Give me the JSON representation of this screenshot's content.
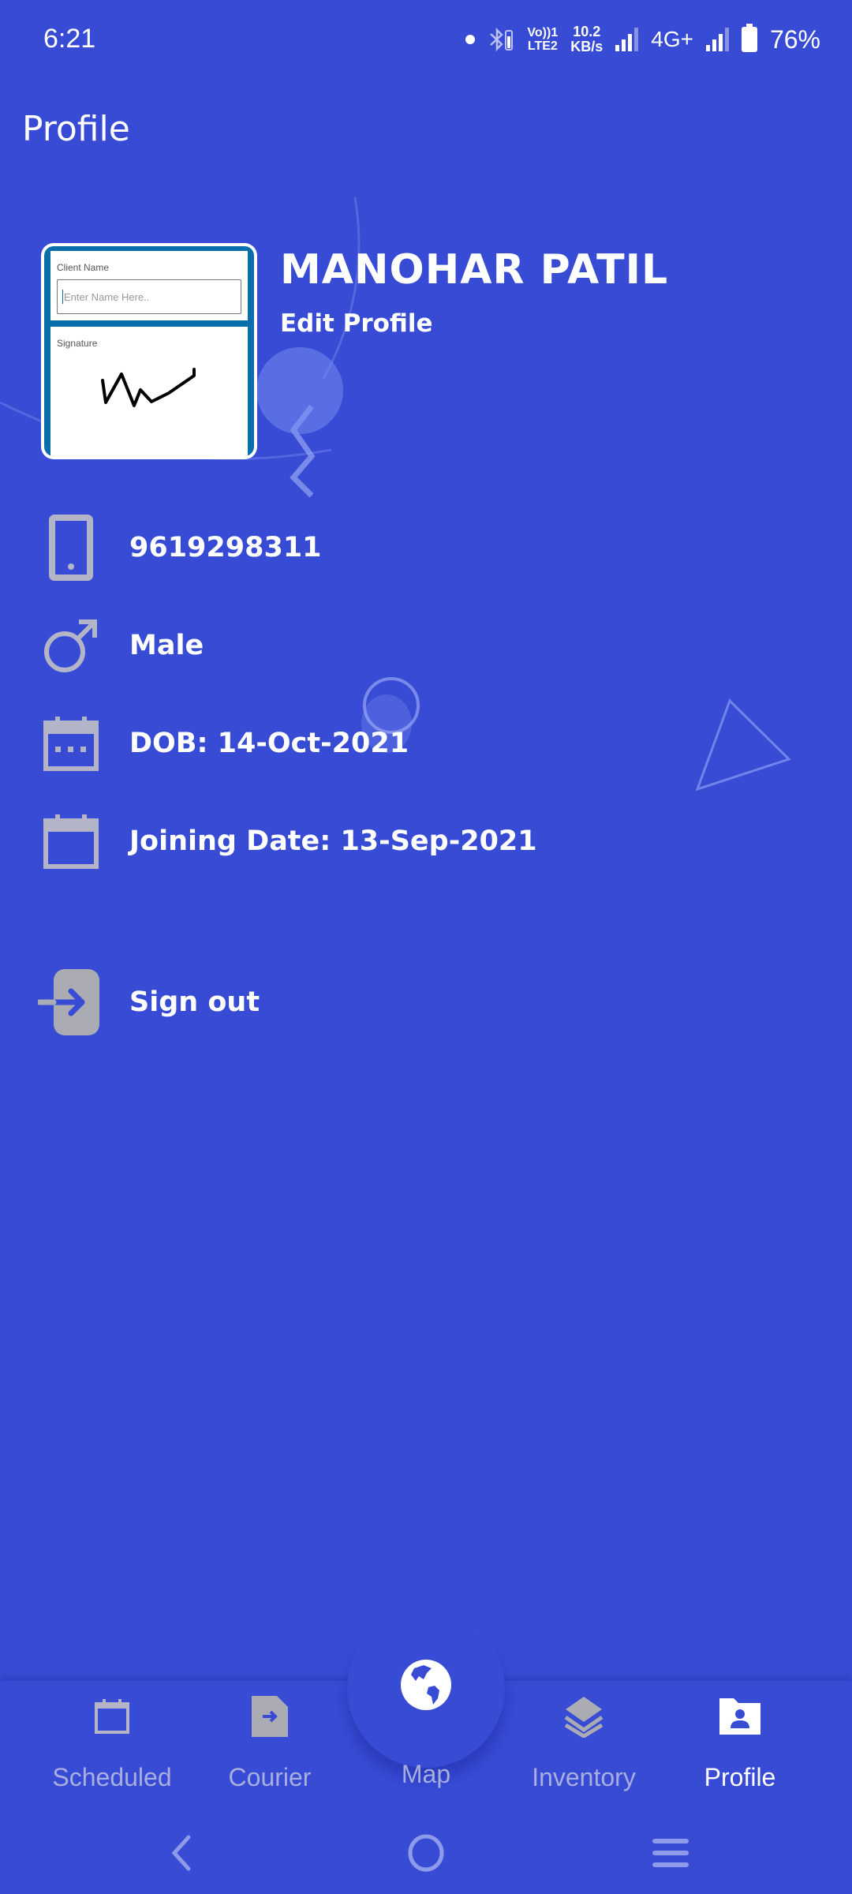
{
  "status_bar": {
    "time": "6:21",
    "volte": "Vo))1",
    "lte": "LTE2",
    "speed_value": "10.2",
    "speed_unit": "KB/s",
    "network": "4G+",
    "battery": "76%"
  },
  "header": {
    "title": "Profile"
  },
  "profile": {
    "name": "MANOHAR PATIL",
    "edit_label": "Edit Profile",
    "image": {
      "client_name_label": "Client Name",
      "client_name_placeholder": "Enter Name Here..",
      "signature_label": "Signature"
    }
  },
  "info": [
    {
      "icon": "phone-icon",
      "label": "9619298311"
    },
    {
      "icon": "male-icon",
      "label": "Male"
    },
    {
      "icon": "calendar-icon",
      "label": "DOB: 14-Oct-2021"
    },
    {
      "icon": "calendar-icon",
      "label": "Joining Date: 13-Sep-2021"
    }
  ],
  "sign_out": {
    "label": "Sign out",
    "icon": "sign-out-icon"
  },
  "bottom_nav": {
    "items": [
      {
        "label": "Scheduled",
        "icon": "calendar-icon",
        "active": false
      },
      {
        "label": "Courier",
        "icon": "file-arrow-icon",
        "active": false
      },
      {
        "label": "Map",
        "icon": "globe-icon",
        "active": false
      },
      {
        "label": "Inventory",
        "icon": "layers-icon",
        "active": false
      },
      {
        "label": "Profile",
        "icon": "profile-folder-icon",
        "active": true
      }
    ]
  },
  "colors": {
    "background": "#374BD4",
    "icon_gray": "#B4B4C8",
    "nav_inactive": "#A9AEE0",
    "card_border": "#0A6EAA"
  }
}
